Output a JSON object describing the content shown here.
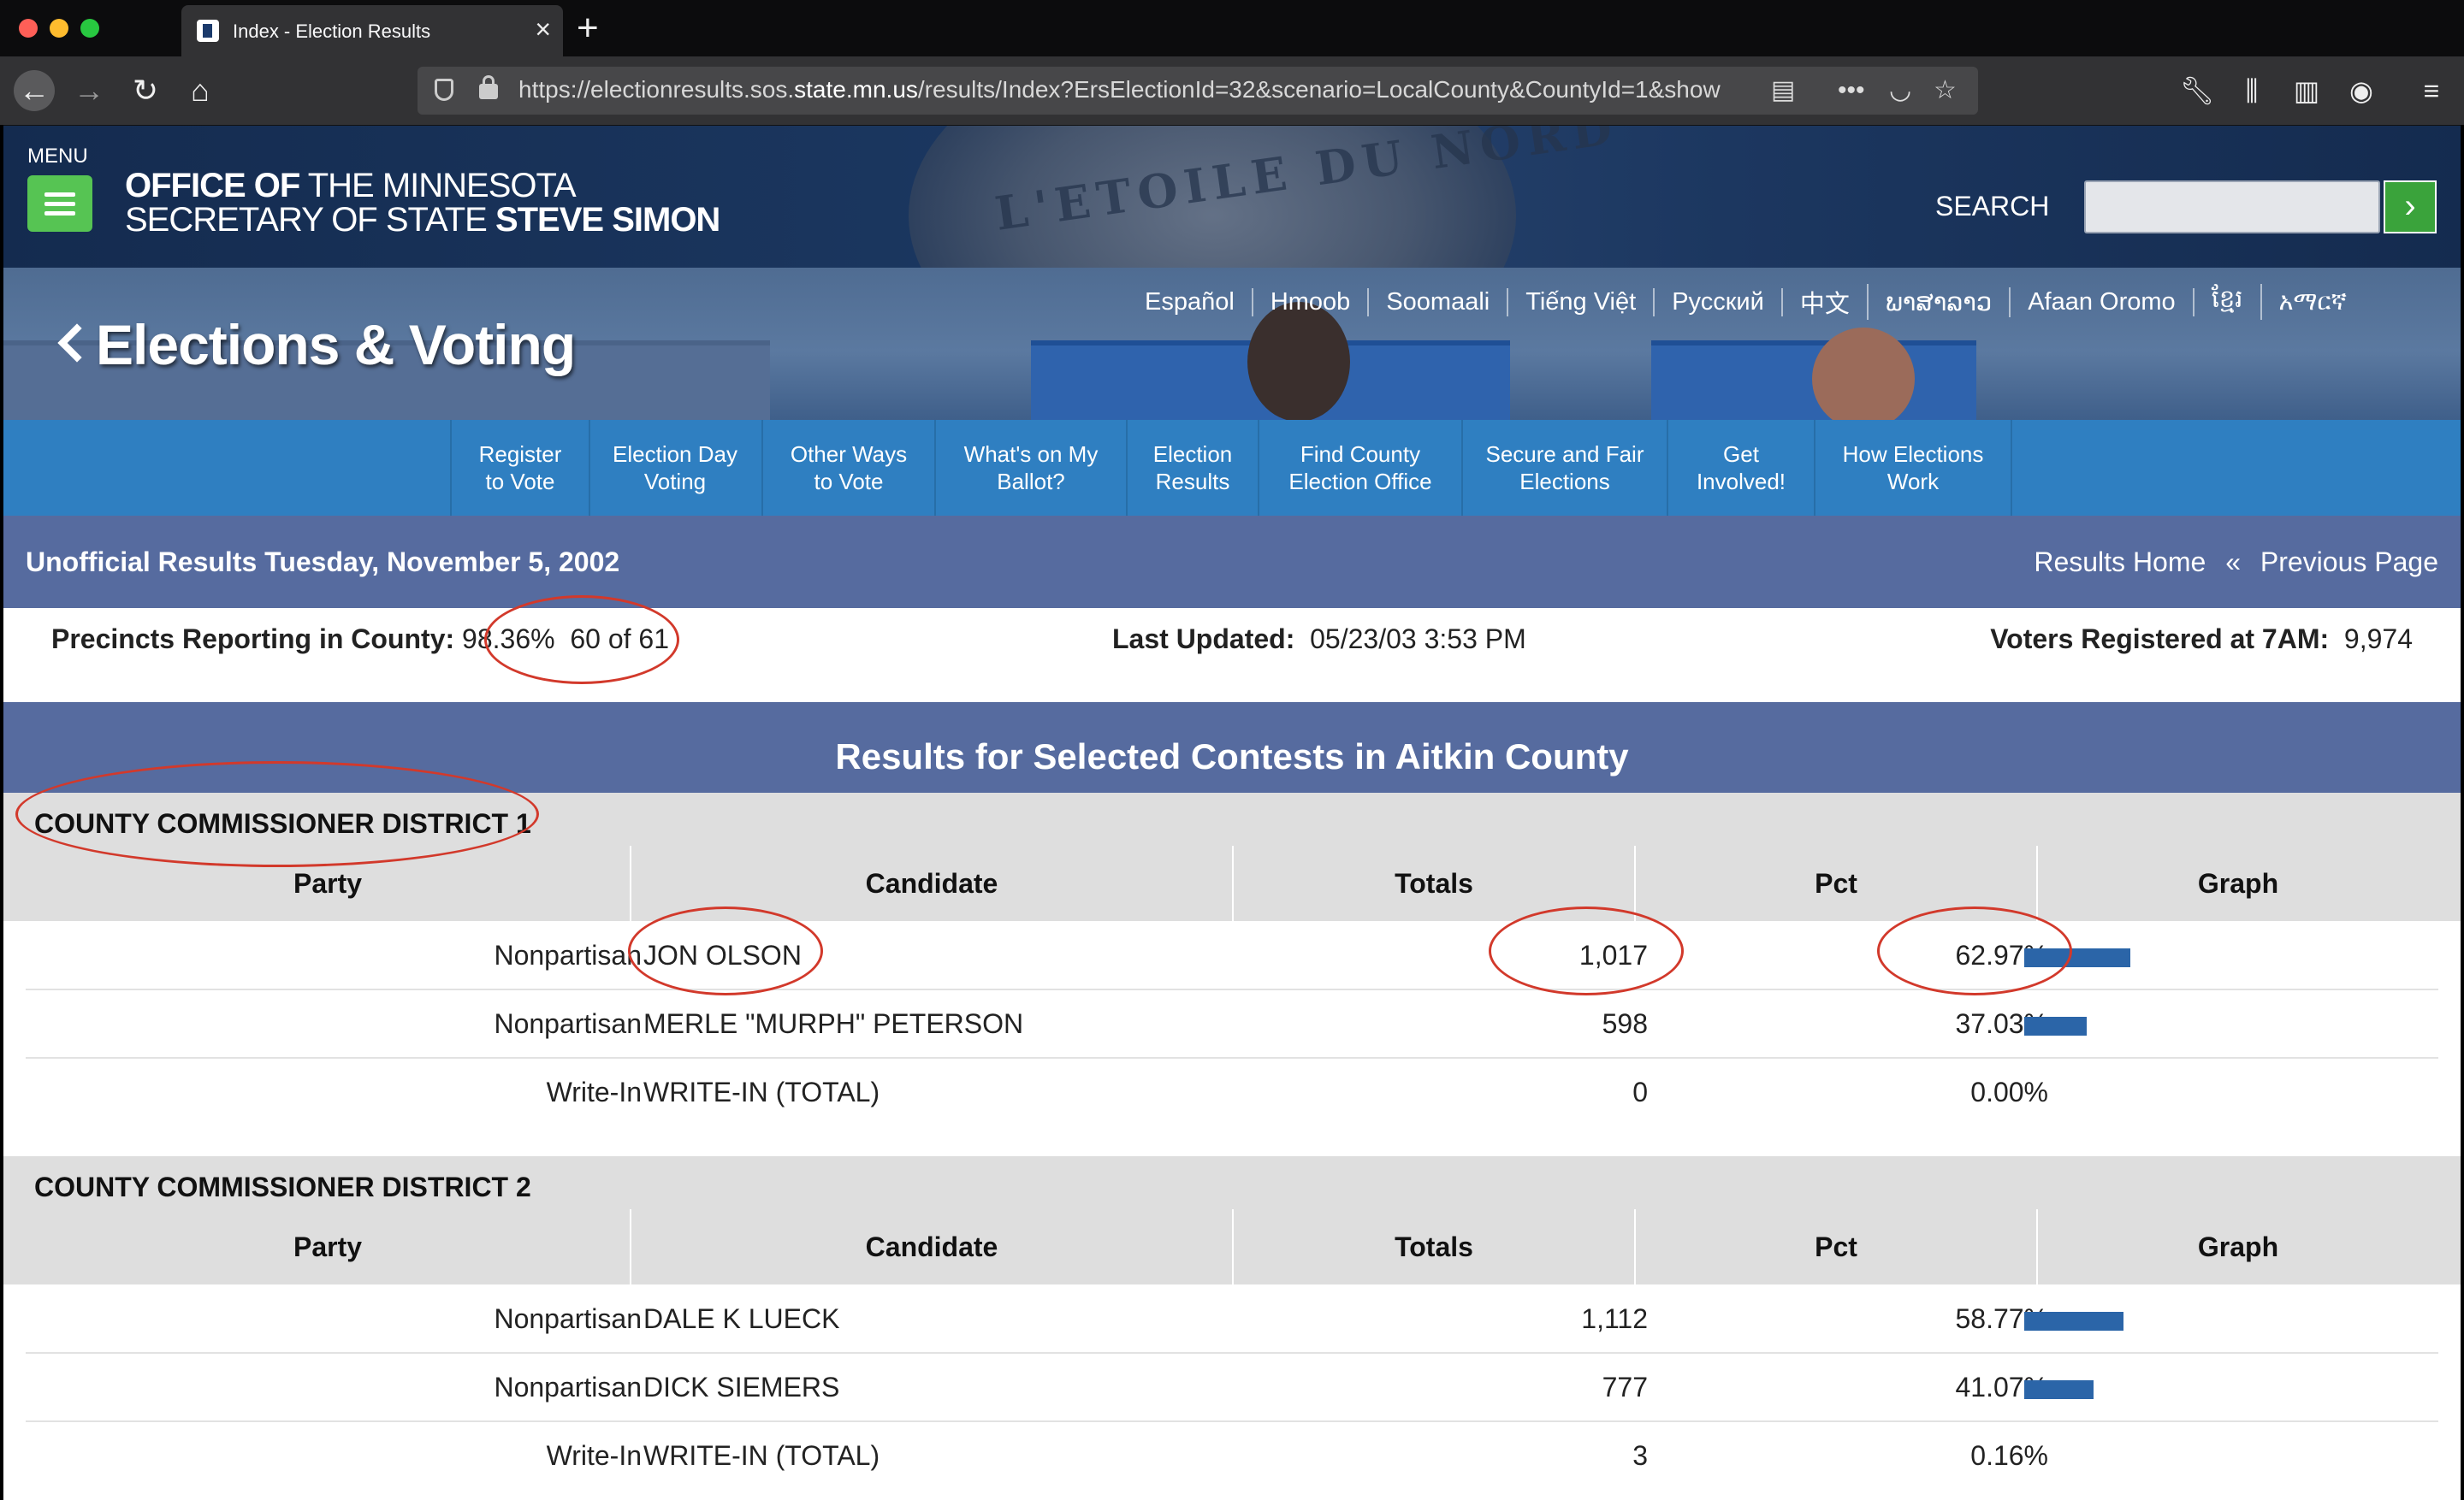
{
  "browser": {
    "tab_title": "Index - Election Results",
    "url_prefix": "https://electionresults.sos.",
    "url_domain": "state.mn.us",
    "url_rest": "/results/Index?ErsElectionId=32&scenario=LocalCounty&CountyId=1&show"
  },
  "header": {
    "menu_label": "MENU",
    "office_bold": "OFFICE OF",
    "office_rest": " THE MINNESOTA",
    "office2_rest": "SECRETARY OF STATE ",
    "office2_bold": "STEVE SIMON",
    "search_label": "SEARCH",
    "seal_text": "L'ETOILE DU NORD"
  },
  "banner": {
    "title": "Elections & Voting",
    "languages": [
      "Español",
      "Hmoob",
      "Soomaali",
      "Tiếng Việt",
      "Русский",
      "中文",
      "ພາສາລາວ",
      "Afaan Oromo",
      "ខ្មែរ",
      "አማርኛ"
    ]
  },
  "nav": {
    "items": [
      {
        "line1": "Register",
        "line2": "to Vote"
      },
      {
        "line1": "Election Day",
        "line2": "Voting"
      },
      {
        "line1": "Other Ways",
        "line2": "to Vote"
      },
      {
        "line1": "What's on My",
        "line2": "Ballot?"
      },
      {
        "line1": "Election",
        "line2": "Results"
      },
      {
        "line1": "Find County",
        "line2": "Election Office"
      },
      {
        "line1": "Secure and Fair",
        "line2": "Elections"
      },
      {
        "line1": "Get",
        "line2": "Involved!"
      },
      {
        "line1": "How Elections",
        "line2": "Work"
      }
    ]
  },
  "results": {
    "heading": "Unofficial Results Tuesday, November 5, 2002",
    "results_home": "Results Home",
    "separator": "«",
    "previous_page": "Previous Page",
    "precincts_label": "Precincts Reporting in County:",
    "precincts_value": "98.36%  60 of 61",
    "updated_label": "Last Updated:",
    "updated_value": "05/23/03 3:53 PM",
    "voters_label": "Voters Registered at 7AM:",
    "voters_value": "9,974",
    "section_title": "Results for Selected Contests in Aitkin County",
    "columns": [
      "Party",
      "Candidate",
      "Totals",
      "Pct",
      "Graph"
    ],
    "contests": [
      {
        "name": "COUNTY COMMISSIONER DISTRICT 1",
        "rows": [
          {
            "party": "Nonpartisan",
            "candidate": "JON OLSON",
            "totals": "1,017",
            "pct": "62.97%",
            "share": 0.6297
          },
          {
            "party": "Nonpartisan",
            "candidate": "MERLE \"MURPH\" PETERSON",
            "totals": "598",
            "pct": "37.03%",
            "share": 0.3703
          },
          {
            "party": "Write-In",
            "candidate": "WRITE-IN (TOTAL)",
            "totals": "0",
            "pct": "0.00%",
            "share": 0.0
          }
        ]
      },
      {
        "name": "COUNTY COMMISSIONER DISTRICT 2",
        "rows": [
          {
            "party": "Nonpartisan",
            "candidate": "DALE K LUECK",
            "totals": "1,112",
            "pct": "58.77%",
            "share": 0.5877
          },
          {
            "party": "Nonpartisan",
            "candidate": "DICK SIEMERS",
            "totals": "777",
            "pct": "41.07%",
            "share": 0.4107
          },
          {
            "party": "Write-In",
            "candidate": "WRITE-IN (TOTAL)",
            "totals": "3",
            "pct": "0.16%",
            "share": 0.0016
          }
        ]
      }
    ]
  },
  "colors": {
    "accent_green": "#56c453",
    "nav_blue": "#2f7fc1",
    "bar_blue": "#2b65a8",
    "annotation_red": "#d2392b"
  }
}
